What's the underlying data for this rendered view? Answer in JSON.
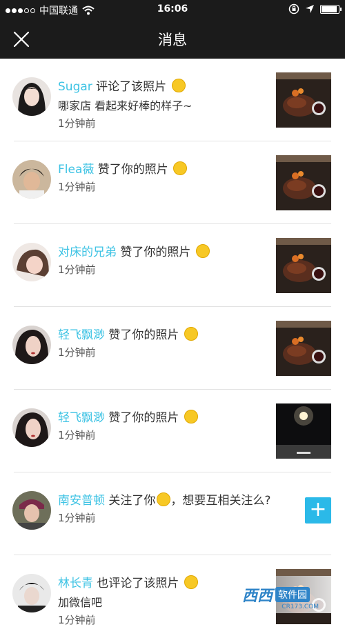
{
  "status_bar": {
    "carrier": "中国联通",
    "time": "16:06",
    "signal_bars_filled": 3,
    "signal_bars_total": 5,
    "battery_level": 0.9
  },
  "nav": {
    "title": "消息"
  },
  "notifications": [
    {
      "name": "Sugar",
      "action": "评论了该照片",
      "emoji": "grin",
      "comment": "哪家店  看起来好棒的样子~",
      "time": "1分钟前",
      "right": "photo-steak"
    },
    {
      "name": "Flea薇",
      "action": "赞了你的照片",
      "emoji": "kiss",
      "comment": "",
      "time": "1分钟前",
      "right": "photo-steak"
    },
    {
      "name": "对床的兄弟",
      "action": "赞了你的照片",
      "emoji": "kiss",
      "comment": "",
      "time": "1分钟前",
      "right": "photo-steak"
    },
    {
      "name": "轻飞飘渺",
      "action": "赞了你的照片",
      "emoji": "kiss",
      "comment": "",
      "time": "1分钟前",
      "right": "photo-steak"
    },
    {
      "name": "轻飞飘渺",
      "action": "赞了你的照片",
      "emoji": "kiss",
      "comment": "",
      "time": "1分钟前",
      "right": "photo-night"
    },
    {
      "name": "南安普顿",
      "action": "关注了你",
      "action2": "，想要互相关注么?",
      "emoji": "smile",
      "comment": "",
      "time": "1分钟前",
      "right": "follow-button",
      "follow_label": "+"
    },
    {
      "name": "林长青",
      "action": "也评论了该照片",
      "emoji": "grin",
      "comment": "加微信吧",
      "time": "1分钟前",
      "right": "photo-steak"
    }
  ],
  "watermark": {
    "logo": "西西",
    "text": "软件园",
    "url": "CR173.COM"
  }
}
